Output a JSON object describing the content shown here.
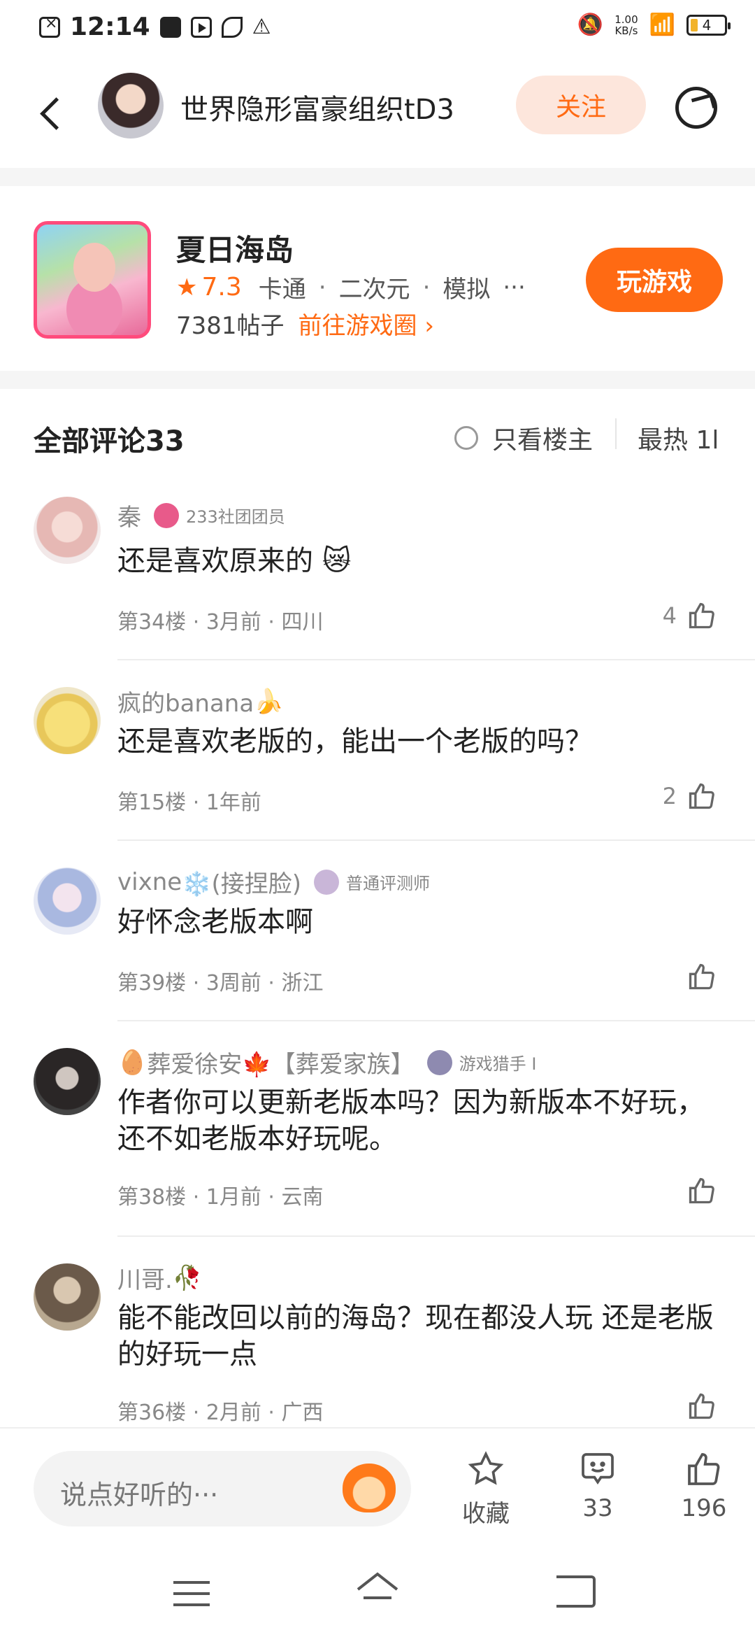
{
  "status_bar": {
    "time": "12:14",
    "net_speed_value": "1.00",
    "net_speed_unit": "KB/s",
    "battery": "4"
  },
  "header": {
    "username": "世界隐形富豪组织tD3",
    "follow_label": "关注"
  },
  "game": {
    "title": "夏日海岛",
    "rating": "7.3",
    "tags": [
      "卡通",
      "二次元",
      "模拟"
    ],
    "more": "···",
    "post_count": "7381帖子",
    "circle_link": "前往游戏圈",
    "play_label": "玩游戏"
  },
  "comments_header": {
    "title": "全部评论33",
    "owner_only": "只看楼主",
    "sort": "最热 1l"
  },
  "comments": [
    {
      "name": "秦",
      "badge": "233社团团员",
      "text": "还是喜欢原来的",
      "emoji": "😿",
      "meta": "第34楼 · 3月前 · 四川",
      "likes": "4"
    },
    {
      "name": "疯的banana",
      "name_suffix": "🍌",
      "badge": "",
      "text": "还是喜欢老版的，能出一个老版的吗？",
      "meta": "第15楼 · 1年前",
      "likes": "2"
    },
    {
      "name": "vixne",
      "name_suffix": "❄️(接捏脸)",
      "badge": "普通评测师",
      "text": "好怀念老版本啊",
      "meta": "第39楼 · 3周前 · 浙江",
      "likes": ""
    },
    {
      "name_prefix": "🥚",
      "name": "葬爱徐安",
      "name_suffix": "🍁【葬爱家族】",
      "badge": "游戏猎手 I",
      "text": "作者你可以更新老版本吗？因为新版本不好玩，还不如老版本好玩呢。",
      "meta": "第38楼 · 1月前 · 云南",
      "likes": ""
    },
    {
      "name": "川哥.",
      "name_suffix": "🥀",
      "badge": "",
      "text": "能不能改回以前的海岛？现在都没人玩 还是老版的好玩一点",
      "meta": "第36楼 · 2月前 · 广西",
      "likes": ""
    }
  ],
  "bottom_bar": {
    "input_placeholder": "说点好听的···",
    "favorite_label": "收藏",
    "comment_count": "33",
    "like_count": "196"
  },
  "colors": {
    "accent": "#ff6a13",
    "follow_bg": "#fde6dc"
  }
}
